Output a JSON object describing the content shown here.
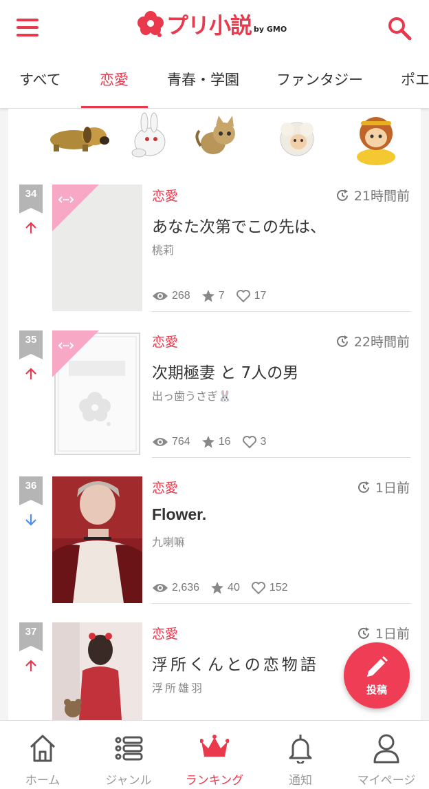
{
  "header": {
    "logo_text": "プリ小説",
    "logo_by": "by GMO"
  },
  "tabs": [
    {
      "label": "すべて",
      "active": false
    },
    {
      "label": "恋愛",
      "active": true
    },
    {
      "label": "青春・学園",
      "active": false
    },
    {
      "label": "ファンタジー",
      "active": false
    },
    {
      "label": "ポエ",
      "active": false
    }
  ],
  "banner": {
    "icons": [
      "dog-icon",
      "rabbit-icon",
      "cat-icon",
      "sheep-icon",
      "monkey-icon"
    ]
  },
  "entries": [
    {
      "rank": "34",
      "trend": "up",
      "genre": "恋愛",
      "time": "21時間前",
      "title": "あなた次第でこの先は、",
      "author": "桃莉",
      "views": "268",
      "stars": "7",
      "likes": "17",
      "thumb": "blank"
    },
    {
      "rank": "35",
      "trend": "up",
      "genre": "恋愛",
      "time": "22時間前",
      "title": "次期極妻 と 7人の男",
      "author": "出っ歯うさぎ🐰",
      "views": "764",
      "stars": "16",
      "likes": "3",
      "thumb": "default"
    },
    {
      "rank": "36",
      "trend": "down",
      "genre": "恋愛",
      "time": "1日前",
      "title": "Flower.",
      "author": "九喇嘛",
      "views": "2,636",
      "stars": "40",
      "likes": "152",
      "thumb": "photo-red"
    },
    {
      "rank": "37",
      "trend": "up",
      "genre": "恋愛",
      "time": "1日前",
      "title": "浮所くんとの恋物語",
      "author": "浮所雄羽",
      "views": "",
      "stars": "",
      "likes": "",
      "thumb": "photo-girl"
    }
  ],
  "fab": {
    "label": "投稿"
  },
  "bottom_nav": [
    {
      "label": "ホーム",
      "icon": "home-icon",
      "active": false
    },
    {
      "label": "ジャンル",
      "icon": "list-icon",
      "active": false
    },
    {
      "label": "ランキング",
      "icon": "crown-icon",
      "active": true
    },
    {
      "label": "通知",
      "icon": "bell-icon",
      "active": false
    },
    {
      "label": "マイページ",
      "icon": "user-icon",
      "active": false
    }
  ],
  "colors": {
    "accent": "#e8394d",
    "up": "#e8394d",
    "down": "#4a8ef0",
    "badge": "#b5b5b5",
    "pink_ribbon": "#f7a8c4"
  }
}
